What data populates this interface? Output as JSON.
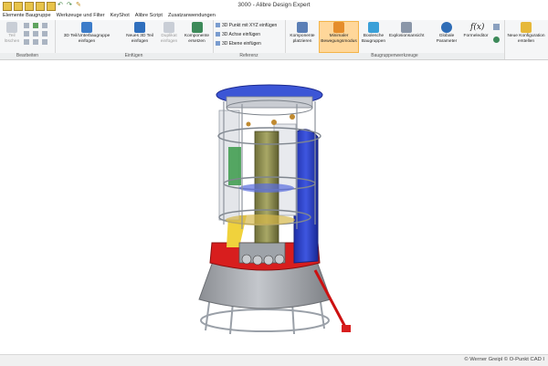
{
  "window": {
    "title": "3000 - Alibre Design Expert"
  },
  "menu": [
    "Elemente Baugruppe",
    "Werkzeuge und Filter",
    "KeyShot",
    "Alibre Script",
    "Zusatzanwendungen"
  ],
  "ribbon": {
    "groups": [
      "Bearbeiten",
      "Einfügen",
      "Referenz",
      "Baugruppenwerkzeuge"
    ],
    "buttons": {
      "teil_loeschen": "Teil löschen",
      "teil_einfuegen": "3D Teil/Unterbaugruppe einfügen",
      "neues_teil": "Neues 3D Teil einfügen",
      "duplikat": "Duplikat einfügen",
      "komponente_ersetzen": "Komponente ersetzen",
      "punkt": "3D Punkt mit XYZ einfügen",
      "achse": "3D Achse einfügen",
      "ebene": "3D Ebene einfügen",
      "komponente_platzieren": "Komponente platzieren",
      "minimaler_modus": "Minimaler Bewegungsmodus",
      "boolesche": "Boolesche Baugruppen",
      "explosion": "Explosionsansicht",
      "globale_parameter": "Globale Parameter",
      "formeleditor": "Formeleditor",
      "neue_konfiguration": "Neue Konfiguration erstellen"
    }
  },
  "status": {
    "copyright": "© Werner Greipl © O-Punkt CAD I"
  },
  "colors": {
    "accent": "#f3b449",
    "model_blue": "#2f44c9",
    "model_red": "#d81e1e",
    "cone_gray": "#a5a8ad"
  }
}
